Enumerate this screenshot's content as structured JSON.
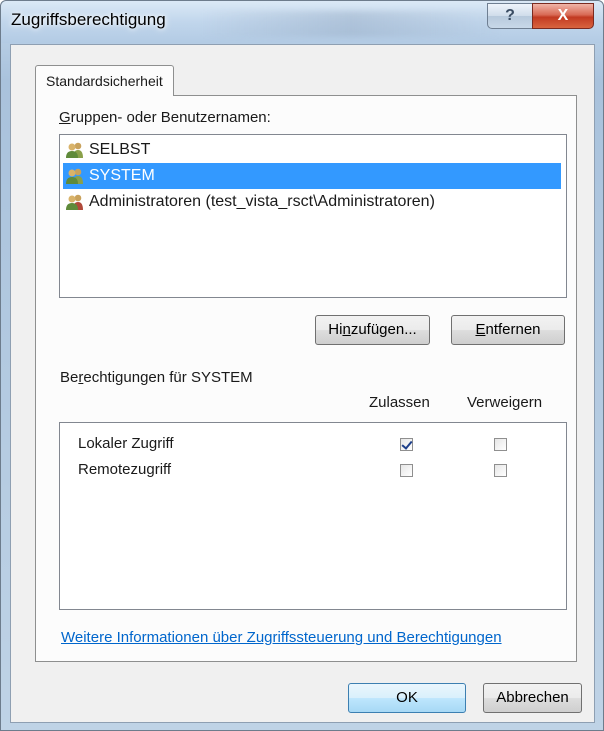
{
  "window": {
    "title": "Zugriffsberechtigung",
    "help_glyph": "?",
    "close_glyph": "X"
  },
  "tabs": [
    {
      "label": "Standardsicherheit",
      "active": true
    }
  ],
  "groups": {
    "label": "Gruppen- oder Benutzernamen:",
    "label_access_key": "G",
    "label_rest": "ruppen- oder Benutzernamen:",
    "items": [
      {
        "name": "SELBST",
        "icon": "user-group-icon",
        "selected": false
      },
      {
        "name": "SYSTEM",
        "icon": "user-group-icon",
        "selected": true
      },
      {
        "name": "Administratoren (test_vista_rsct\\Administratoren)",
        "icon": "user-group-icon",
        "selected": false
      }
    ]
  },
  "buttons": {
    "add": {
      "pre": "Hi",
      "key": "n",
      "post": "zufügen..."
    },
    "remove": {
      "pre": "",
      "key": "E",
      "post": "ntfernen"
    },
    "ok": "OK",
    "cancel": "Abbrechen"
  },
  "permissions": {
    "label_pre": "Be",
    "label_key": "r",
    "label_post": "echtigungen für SYSTEM",
    "columns": {
      "allow": "Zulassen",
      "deny": "Verweigern"
    },
    "rows": [
      {
        "name": "Lokaler Zugriff",
        "allow": true,
        "deny": false
      },
      {
        "name": "Remotezugriff",
        "allow": false,
        "deny": false
      }
    ]
  },
  "link": "Weitere Informationen über Zugriffssteuerung und Berechtigungen",
  "colors": {
    "selection": "#3399ff",
    "link": "#0066cc",
    "close_button": "#c23a22"
  }
}
